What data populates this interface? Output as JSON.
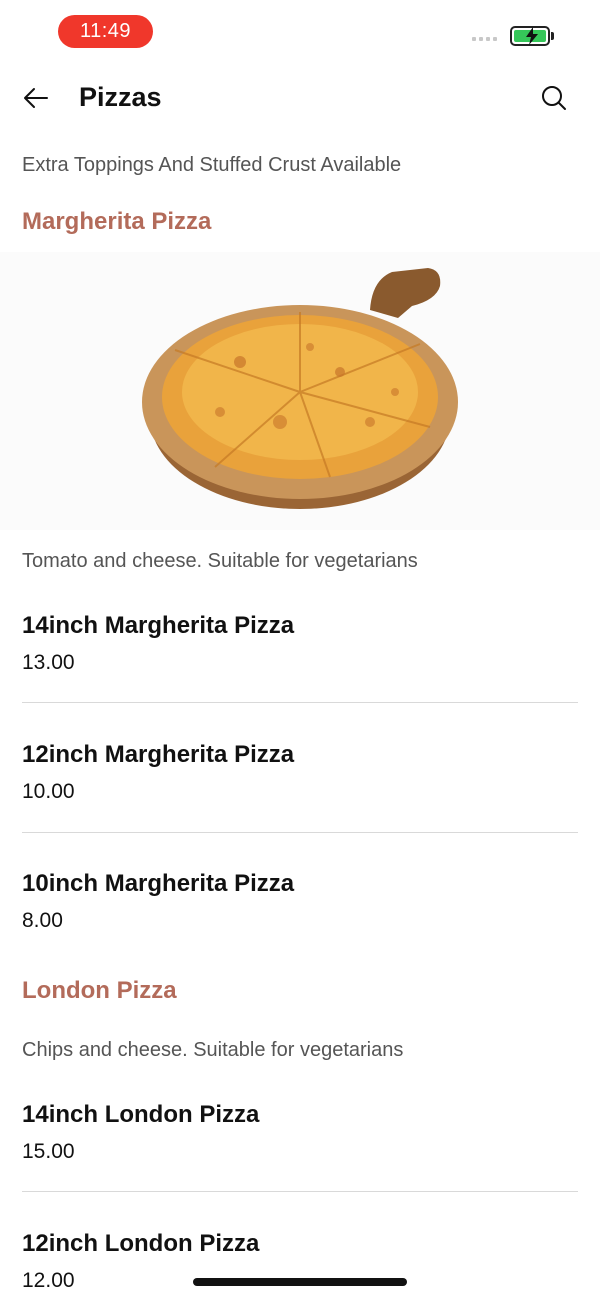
{
  "status_bar": {
    "time": "11:49"
  },
  "header": {
    "title": "Pizzas",
    "back_icon": "arrow-left-icon",
    "search_icon": "search-icon"
  },
  "category": {
    "subtitle": "Extra Toppings And Stuffed Crust Available"
  },
  "sections": [
    {
      "title": "Margherita Pizza",
      "description": "Tomato and cheese. Suitable for vegetarians",
      "items": [
        {
          "name": "14inch Margherita Pizza",
          "price": "13.00"
        },
        {
          "name": "12inch Margherita Pizza",
          "price": "10.00"
        },
        {
          "name": "10inch Margherita Pizza",
          "price": "8.00"
        }
      ]
    },
    {
      "title": "London Pizza",
      "description": "Chips and cheese. Suitable for vegetarians",
      "items": [
        {
          "name": "14inch London Pizza",
          "price": "15.00"
        },
        {
          "name": "12inch London Pizza",
          "price": "12.00"
        }
      ]
    }
  ],
  "colors": {
    "accent": "#b36b5a",
    "time_pill": "#f0372b",
    "battery": "#35c759"
  }
}
